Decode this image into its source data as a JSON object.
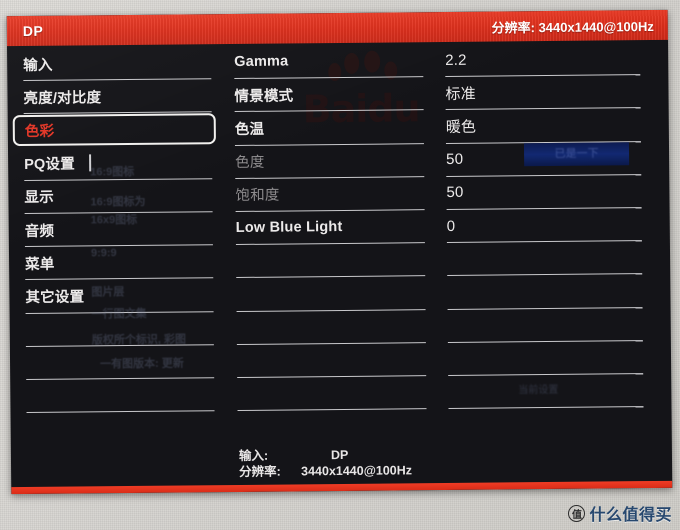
{
  "header": {
    "source_label": "DP",
    "resolution_label": "分辨率:",
    "resolution_value": "3440x1440@100Hz",
    "resolution_full": "分辨率: 3440x1440@100Hz",
    "accent_color": "#dd2e1b"
  },
  "sidebar": {
    "items": [
      {
        "label": "输入",
        "selected": false
      },
      {
        "label": "亮度/对比度",
        "selected": false
      },
      {
        "label": "色彩",
        "selected": true
      },
      {
        "label": "PQ设置",
        "selected": false
      },
      {
        "label": "显示",
        "selected": false
      },
      {
        "label": "音频",
        "selected": false
      },
      {
        "label": "菜单",
        "selected": false
      },
      {
        "label": "其它设置",
        "selected": false
      }
    ],
    "selected_color": "#e2392a"
  },
  "settings": {
    "items": [
      {
        "label": "Gamma",
        "value": "2.2",
        "dim": false
      },
      {
        "label": "情景模式",
        "value": "标准",
        "dim": false
      },
      {
        "label": "色温",
        "value": "暖色",
        "dim": false
      },
      {
        "label": "色度",
        "value": "50",
        "dim": true
      },
      {
        "label": "饱和度",
        "value": "50",
        "dim": true
      },
      {
        "label": "Low Blue Light",
        "value": "0",
        "dim": false
      }
    ]
  },
  "status": {
    "input_label": "输入:",
    "input_value": "DP",
    "resolution_label": "分辨率:",
    "resolution_value": "3440x1440@100Hz"
  },
  "watermark": {
    "badge": "值",
    "name": "什么值得买",
    "ghost_brand": "Baidu"
  }
}
